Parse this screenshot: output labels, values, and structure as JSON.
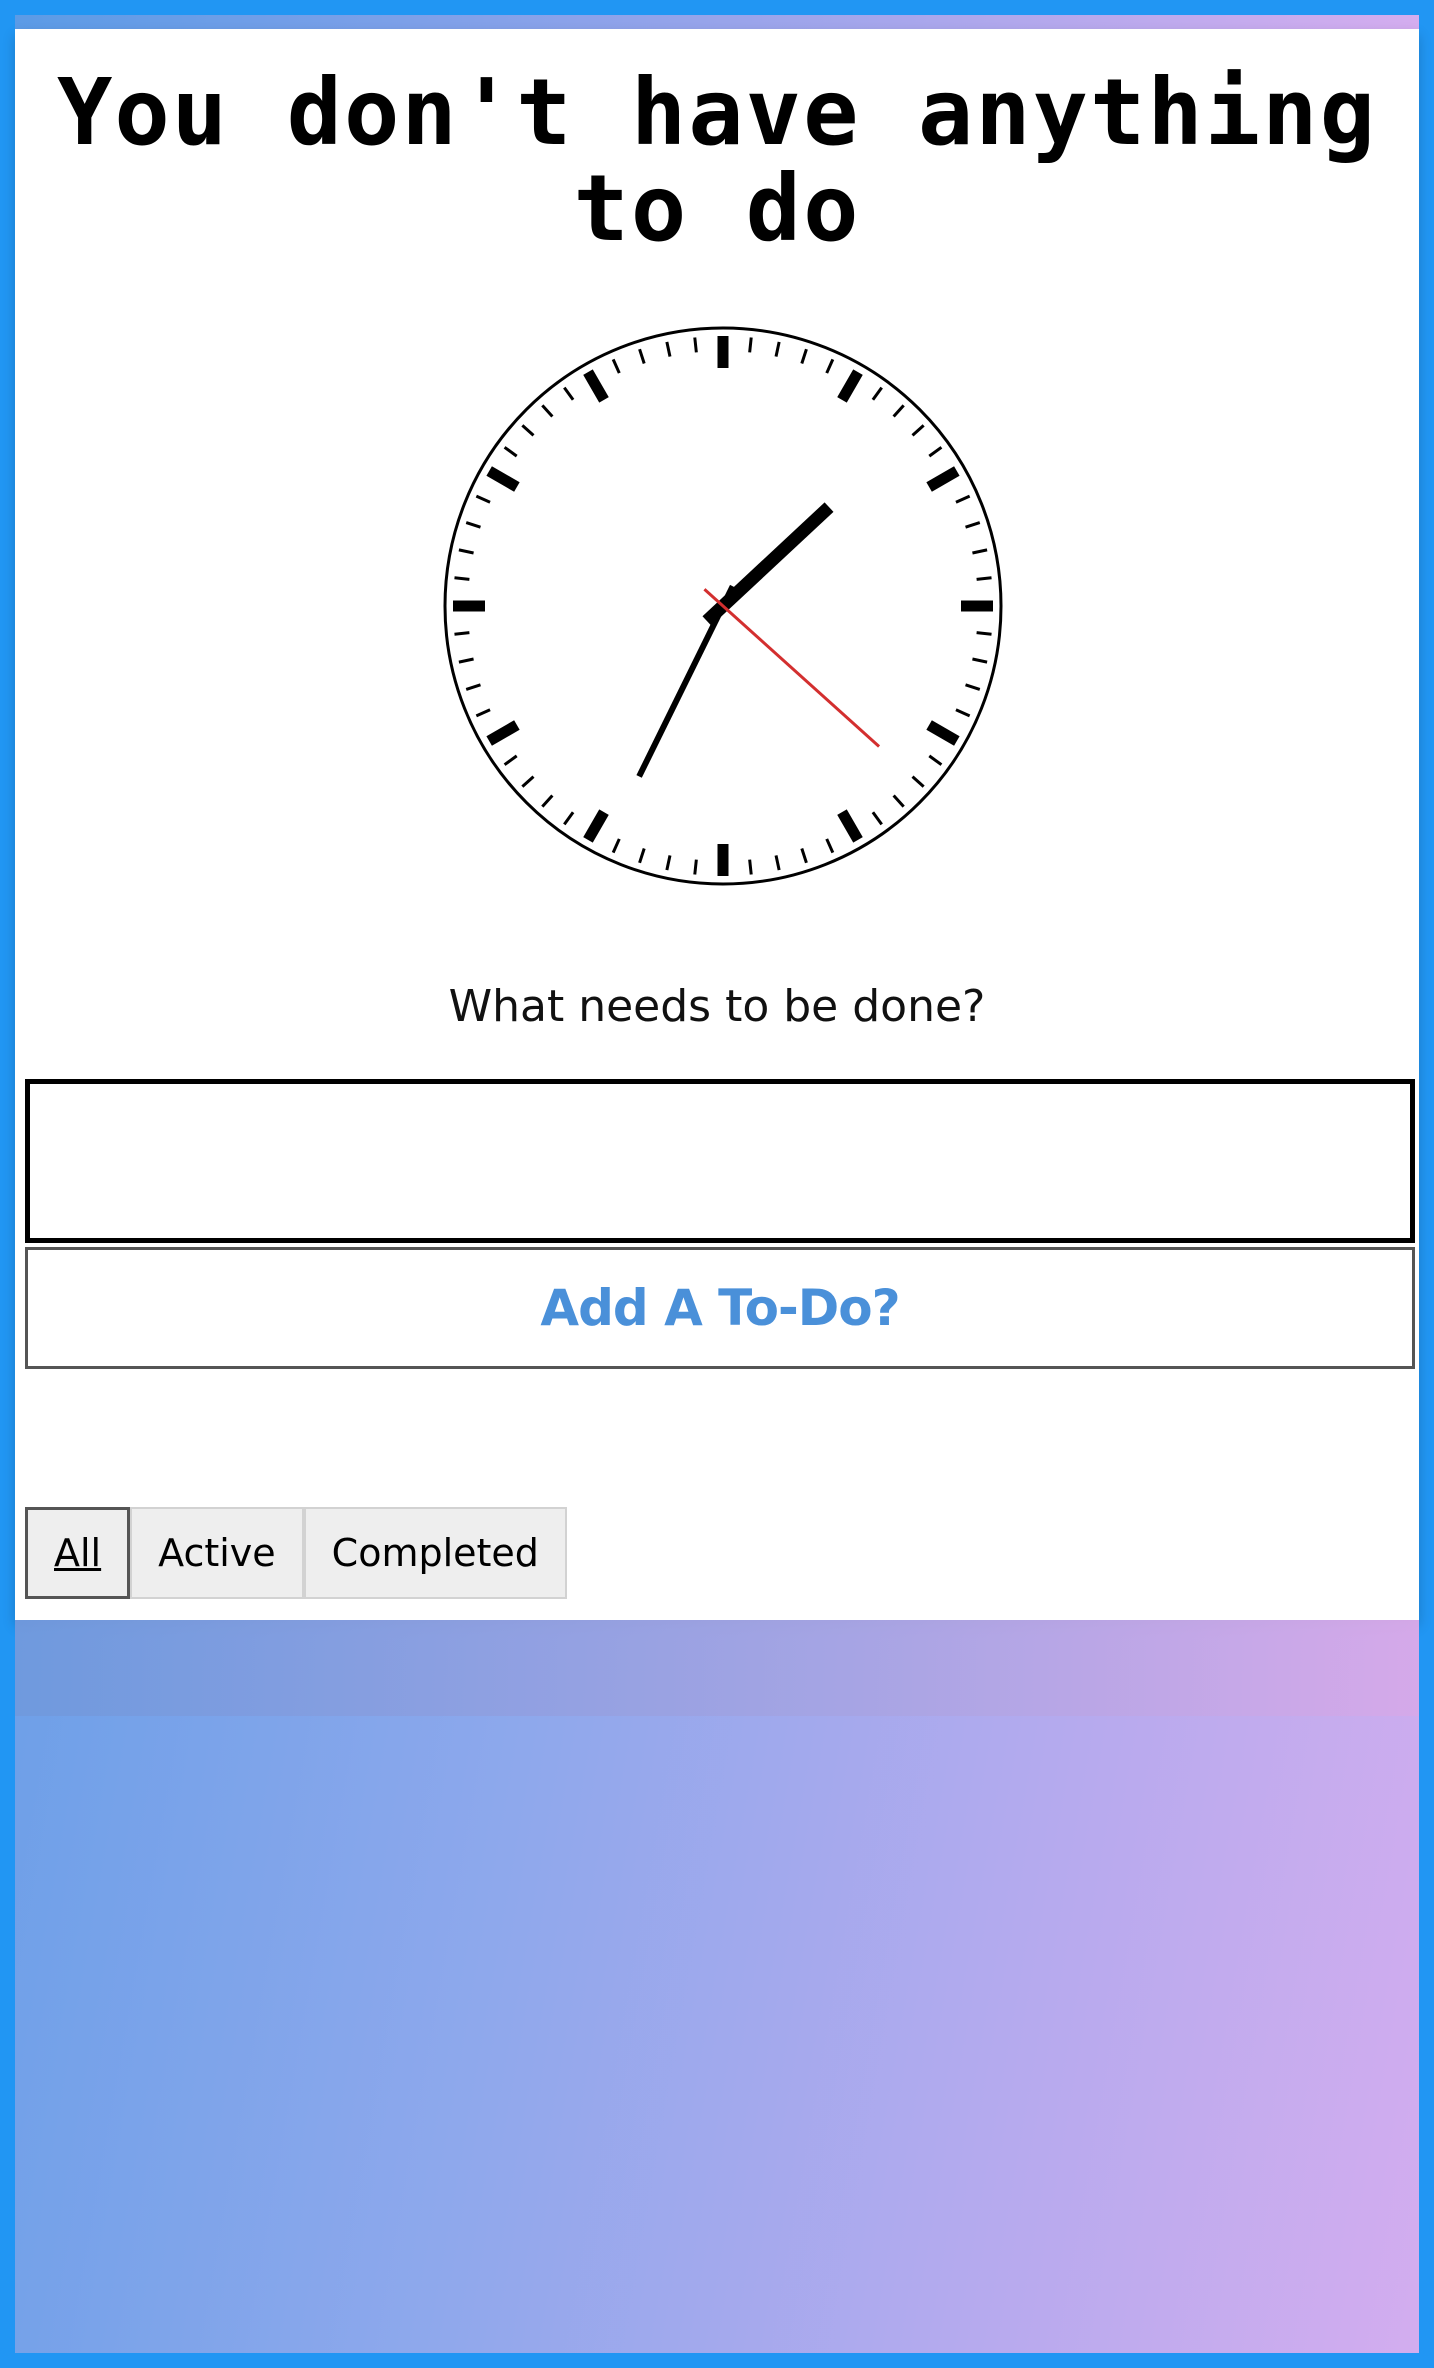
{
  "header": {
    "title": "You don't have anything to do"
  },
  "clock": {
    "hour": 1,
    "minute": 34,
    "second": 22
  },
  "form": {
    "prompt": "What needs to be done?",
    "input_value": "",
    "add_button_label": "Add A To-Do?"
  },
  "filters": {
    "all_label": "All",
    "active_label": "Active",
    "completed_label": "Completed",
    "selected": "All"
  },
  "colors": {
    "border": "#2196f3",
    "accent": "#4a90d9",
    "second_hand": "#d32f2f",
    "gradient_start": "#5b9be6",
    "gradient_end": "#d4adef"
  }
}
